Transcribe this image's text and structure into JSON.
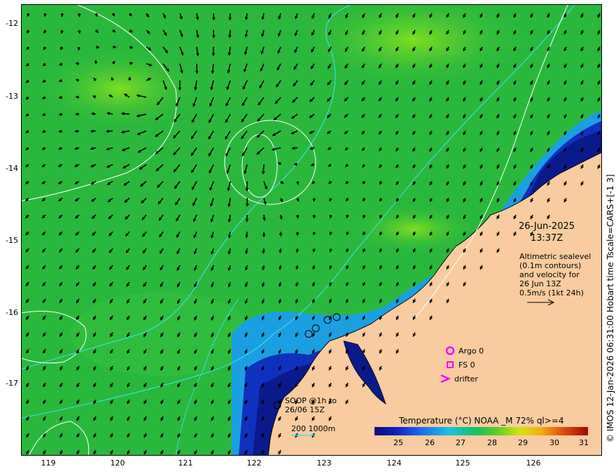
{
  "y_ticks": [
    "-12",
    "-13",
    "-14",
    "-15",
    "-16",
    "-17"
  ],
  "x_ticks": [
    "119",
    "120",
    "121",
    "122",
    "123",
    "124",
    "125",
    "126"
  ],
  "date": "26-Jun-2025",
  "time": "13:37Z",
  "info_lines": [
    "Altimetric sealevel",
    "(0.1m contours)",
    "and velocity for",
    "26 Jun 13Z",
    "0.5m/s (1kt 24h)"
  ],
  "legend": {
    "argo": "Argo 0",
    "fs": "FS 0",
    "drifter": "drifter"
  },
  "soop_lines": [
    "SOOP @1h to",
    "26/06 15Z"
  ],
  "bathy_label": "200  1000m",
  "colorbar": {
    "title": "Temperature (°C) NOAA _M 72% ql>=4",
    "ticks": [
      "25",
      "26",
      "27",
      "28",
      "29",
      "30",
      "31"
    ]
  },
  "credit": "© IMOS 12-Jan-2026 06:31:00 Hobart time Tscale=CARS+[-1 3]",
  "colors": {
    "land": "#f8cca0",
    "warm_water": "#2ab83c",
    "cool_water": "#0a1a8a",
    "bathy_contour": "#40e0ff",
    "sealevel_contour": "#ffffff",
    "marker_magenta": "#ff00ff"
  }
}
